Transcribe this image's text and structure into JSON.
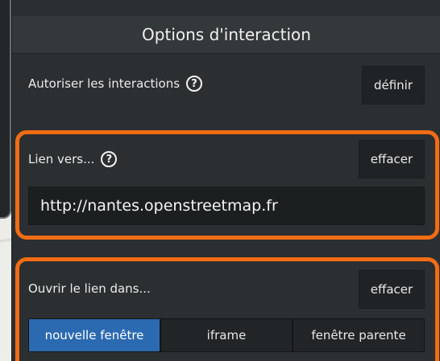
{
  "panel": {
    "title": "Options d'interaction",
    "allow_interactions": {
      "label": "Autoriser les interactions",
      "help": "?",
      "button": "définir"
    },
    "link_to": {
      "label": "Lien vers...",
      "help": "?",
      "button": "effacer",
      "value": "http://nantes.openstreetmap.fr"
    },
    "open_link_in": {
      "label": "Ouvrir le lien dans...",
      "button": "effacer",
      "options": [
        "nouvelle fenêtre",
        "iframe",
        "fenêtre parente"
      ],
      "selected": "nouvelle fenêtre"
    }
  },
  "colors": {
    "highlight": "#f26c14",
    "selected_option": "#2b6ab0"
  }
}
